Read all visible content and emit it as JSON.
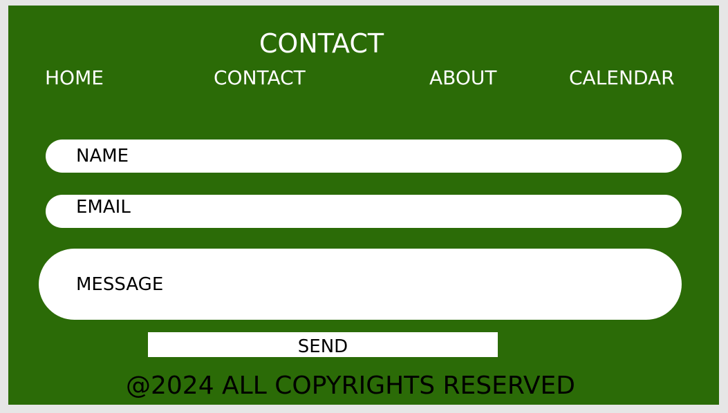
{
  "header": {
    "title": "CONTACT"
  },
  "nav": {
    "items": [
      {
        "label": "HOME"
      },
      {
        "label": "CONTACT"
      },
      {
        "label": "ABOUT"
      },
      {
        "label": "CALENDAR"
      }
    ]
  },
  "form": {
    "name_placeholder": "NAME",
    "email_placeholder": "EMAIL",
    "message_placeholder": "MESSAGE",
    "send_label": "SEND"
  },
  "footer": {
    "text": "@2024 ALL COPYRIGHTS RESERVED"
  },
  "colors": {
    "background": "#2b6b07",
    "frame_border": "#e6e6e6",
    "field": "#ffffff",
    "text_light": "#ffffff",
    "text_dark": "#000000"
  }
}
